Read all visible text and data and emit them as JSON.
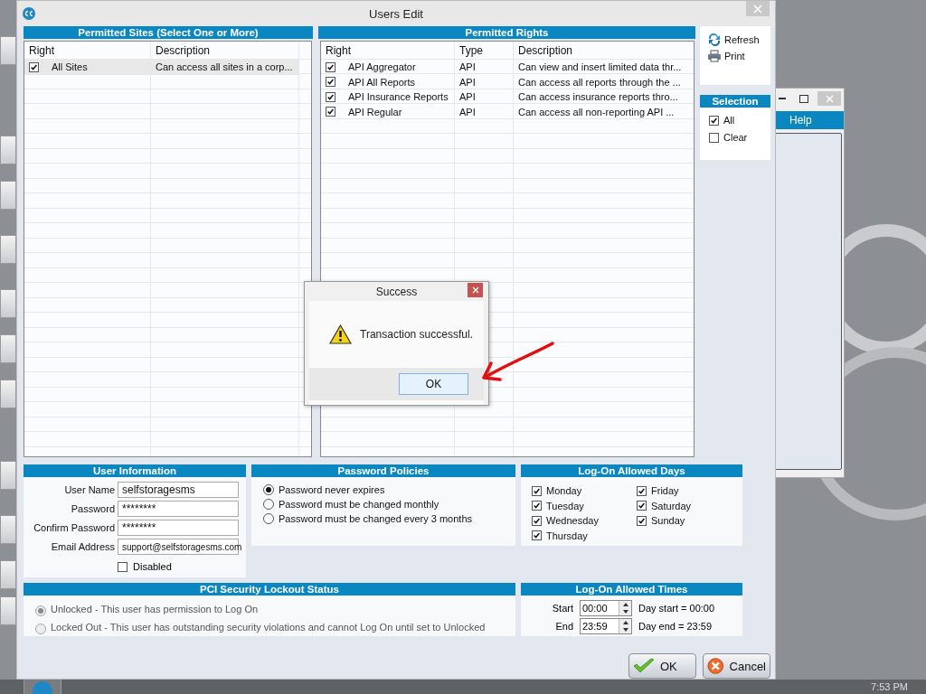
{
  "window": {
    "title": "Users Edit"
  },
  "permitted_sites": {
    "title": "Permitted Sites (Select One or More)",
    "columns": [
      "Right",
      "Description"
    ],
    "rows": [
      {
        "checked": true,
        "selected": true,
        "right": "All Sites",
        "description": "Can access all sites in a corp..."
      }
    ]
  },
  "permitted_rights": {
    "title": "Permitted Rights",
    "columns": [
      "Right",
      "Type",
      "Description"
    ],
    "rows": [
      {
        "checked": true,
        "right": "API Aggregator",
        "type": "API",
        "description": "Can view and insert limited data thr..."
      },
      {
        "checked": true,
        "right": "API All Reports",
        "type": "API",
        "description": "Can access all reports through the ..."
      },
      {
        "checked": true,
        "right": "API Insurance Reports",
        "type": "API",
        "description": "Can access insurance reports thro..."
      },
      {
        "checked": true,
        "right": "API Regular",
        "type": "API",
        "description": "Can access all non-reporting API ..."
      }
    ]
  },
  "toolbar": [
    {
      "kind": "refresh",
      "label": "Refresh"
    },
    {
      "kind": "print",
      "label": "Print"
    }
  ],
  "selection": {
    "title": "Selection",
    "options": [
      {
        "label": "All",
        "checked": true
      },
      {
        "label": "Clear",
        "checked": false
      }
    ]
  },
  "user_information": {
    "title": "User Information",
    "fields": [
      {
        "label": "User Name",
        "value": "selfstoragesms"
      },
      {
        "label": "Password",
        "value": "********"
      },
      {
        "label": "Confirm Password",
        "value": "********"
      },
      {
        "label": "Email Address",
        "value": "support@selfstoragesms.com"
      }
    ],
    "disabled": {
      "label": "Disabled",
      "checked": false
    }
  },
  "password_policies": {
    "title": "Password Policies",
    "options": [
      {
        "label": "Password never expires",
        "selected": true
      },
      {
        "label": "Password must be changed monthly",
        "selected": false
      },
      {
        "label": "Password must be changed every 3 months",
        "selected": false
      }
    ]
  },
  "allowed_days": {
    "title": "Log-On Allowed Days",
    "days": [
      {
        "label": "Monday",
        "checked": true
      },
      {
        "label": "Tuesday",
        "checked": true
      },
      {
        "label": "Wednesday",
        "checked": true
      },
      {
        "label": "Thursday",
        "checked": true
      },
      {
        "label": "Friday",
        "checked": true
      },
      {
        "label": "Saturday",
        "checked": true
      },
      {
        "label": "Sunday",
        "checked": true
      }
    ]
  },
  "lockout": {
    "title": "PCI Security Lockout Status",
    "disabled": true,
    "options": [
      {
        "label": "Unlocked - This user has permission to Log On",
        "selected": true
      },
      {
        "label": "Locked Out - This user has outstanding security violations and cannot Log On until set to Unlocked",
        "selected": false
      }
    ]
  },
  "allowed_times": {
    "title": "Log-On Allowed Times",
    "rows": [
      {
        "label": "Start",
        "value": "00:00",
        "note": "Day start = 00:00"
      },
      {
        "label": "End",
        "value": "23:59",
        "note": "Day end = 23:59"
      }
    ]
  },
  "buttons": [
    {
      "kind": "ok",
      "label": "OK"
    },
    {
      "kind": "cancel",
      "label": "Cancel"
    }
  ],
  "background_window": {
    "menu": [
      "Help"
    ]
  },
  "dialog": {
    "title": "Success",
    "message": "Transaction successful.",
    "button": "OK"
  },
  "taskbar": {
    "clock": "7:53 PM"
  }
}
